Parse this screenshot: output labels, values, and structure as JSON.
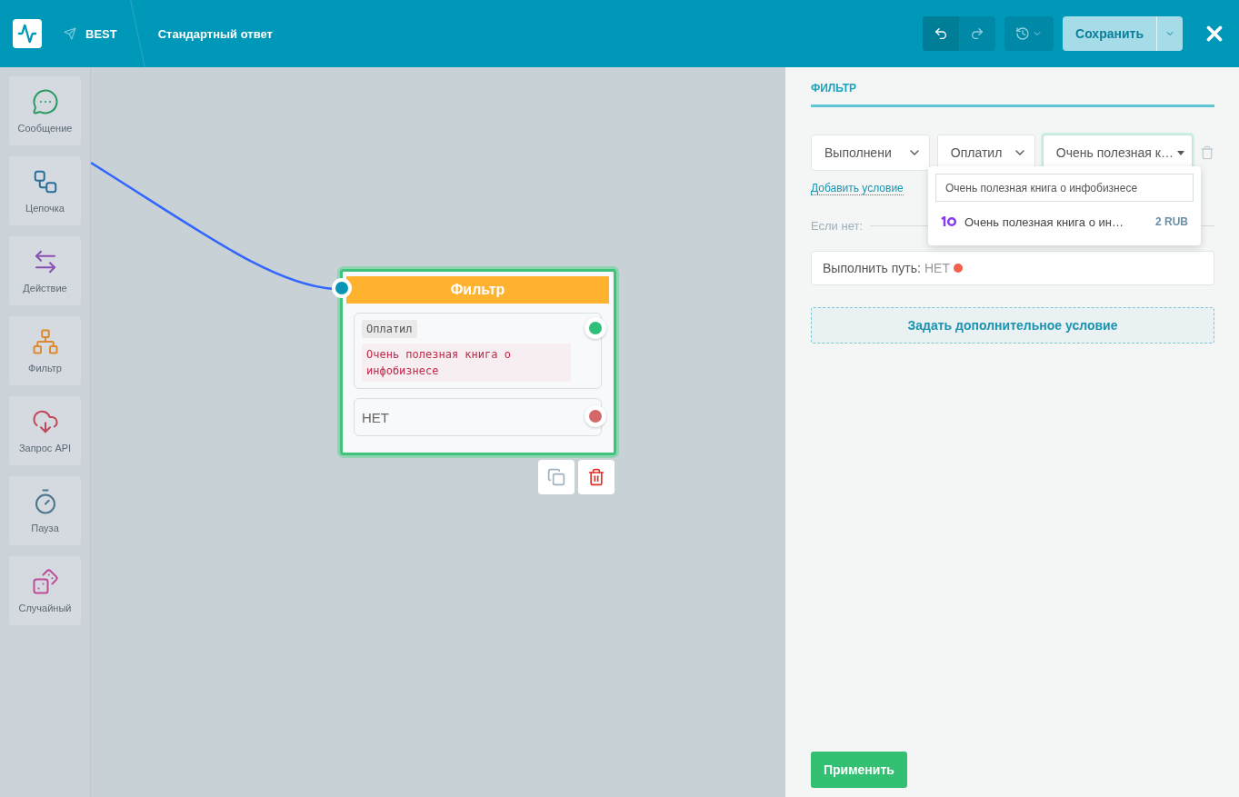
{
  "header": {
    "project": "BEST",
    "breadcrumb": "Стандартный ответ",
    "save_label": "Сохранить"
  },
  "palette": [
    {
      "label": "Сообщение",
      "kind": "message"
    },
    {
      "label": "Цепочка",
      "kind": "chain"
    },
    {
      "label": "Действие",
      "kind": "action"
    },
    {
      "label": "Фильтр",
      "kind": "filter"
    },
    {
      "label": "Запрос API",
      "kind": "api"
    },
    {
      "label": "Пауза",
      "kind": "pause"
    },
    {
      "label": "Случайный",
      "kind": "random"
    }
  ],
  "node": {
    "title": "Фильтр",
    "outputs": [
      {
        "kind": "condition",
        "tag": "Оплатил",
        "value": "Очень полезная книга о инфобизнесе",
        "color": "#2ebf7a"
      },
      {
        "kind": "else",
        "label": "НЕТ",
        "color": "#d46868"
      }
    ]
  },
  "panel": {
    "tab": "ФИЛЬТР",
    "selects": [
      {
        "value": "Выполнени",
        "expanded": false
      },
      {
        "value": "Оплатил",
        "expanded": false
      },
      {
        "value": "Очень полезная к…",
        "expanded": true
      }
    ],
    "add_condition": "Добавить условие",
    "else_label": "Если нет:",
    "path_label": "Выполнить путь:",
    "path_value": "НЕТ",
    "extra_condition": "Задать дополнительное условие",
    "apply": "Применить"
  },
  "dropdown": {
    "search_value": "Очень полезная книга о инфобизнесе",
    "options": [
      {
        "label": "Очень полезная книга о ин…",
        "price": "2 RUB"
      }
    ]
  }
}
